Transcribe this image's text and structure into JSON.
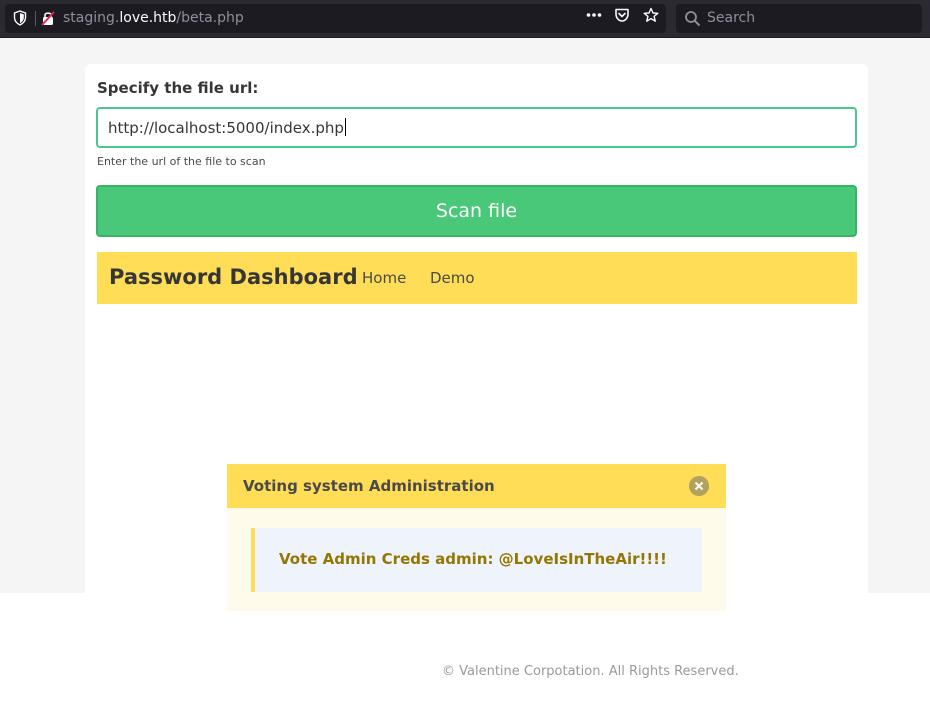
{
  "browser": {
    "url_prefix": "staging.",
    "url_host": "love.htb",
    "url_path": "/beta.php",
    "search_placeholder": "Search"
  },
  "form": {
    "label": "Specify the file url:",
    "input_value": "http://localhost:5000/index.php",
    "help_text": "Enter the url of the file to scan",
    "scan_button": "Scan file"
  },
  "navbar": {
    "brand": "Password Dashboard",
    "items": [
      {
        "label": "Home"
      },
      {
        "label": "Demo"
      }
    ]
  },
  "modal": {
    "title": "Voting system Administration",
    "message": "Vote Admin Creds admin: @LoveIsInTheAir!!!!"
  },
  "footer": {
    "text": "© Valentine Corpotation. All Rights Reserved."
  },
  "colors": {
    "success": "#48c878",
    "warning": "#ffdd57",
    "info_bg": "#eff3fb"
  }
}
